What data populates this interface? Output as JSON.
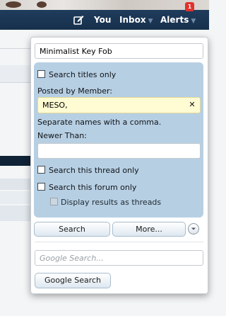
{
  "navbar": {
    "you_label": "You",
    "inbox_label": "Inbox",
    "alerts_label": "Alerts",
    "alerts_count": "1"
  },
  "search": {
    "keyword_value": "Minimalist Key Fob",
    "titles_only_label": "Search titles only",
    "posted_by_label": "Posted by Member:",
    "member_value": "MESO,",
    "clear_symbol": "✕",
    "separate_hint": "Separate names with a comma.",
    "newer_than_label": "Newer Than:",
    "newer_than_value": "",
    "this_thread_label": "Search this thread only",
    "this_forum_label": "Search this forum only",
    "as_threads_label": "Display results as threads",
    "search_button": "Search",
    "more_button": "More...",
    "google_placeholder": "Google Search...",
    "google_button": "Google Search"
  },
  "colors": {
    "navbar": "#1b3656",
    "panel": "#b7cfe3",
    "badge": "#e1312e",
    "member_field": "#fffbd2"
  }
}
